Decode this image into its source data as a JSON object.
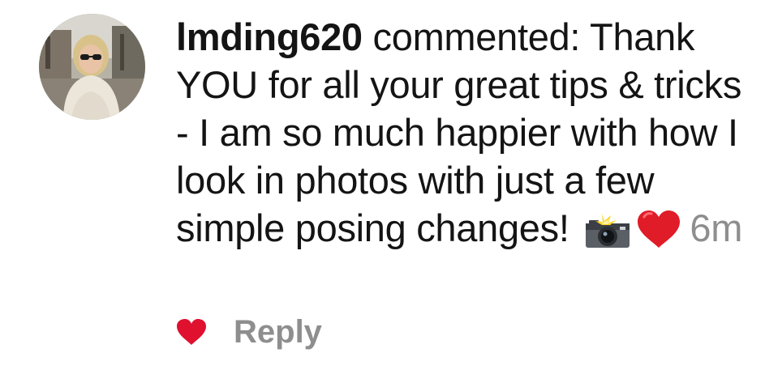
{
  "comment": {
    "username": "lmding620",
    "text": "commented: Thank YOU for all your great tips & tricks - I am so much happier with how I look in photos with just a few simple posing changes!",
    "emojis": [
      "camera-with-flash",
      "red-heart"
    ],
    "timestamp": "6m",
    "avatar_icon": "profile-photo"
  },
  "actions": {
    "like_icon": "heart-icon",
    "like_color": "#e0102f",
    "reply_label": "Reply"
  },
  "colors": {
    "text": "#141414",
    "muted": "#8e8e8e"
  }
}
